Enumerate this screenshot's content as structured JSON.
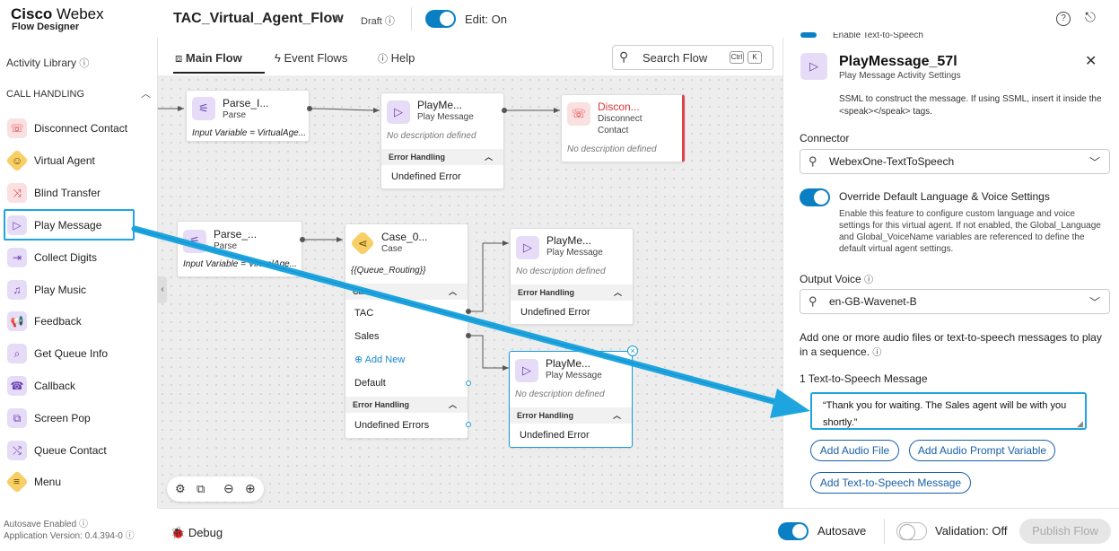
{
  "header": {
    "brand_line1_bold": "Cisco",
    "brand_line1_rest": " Webex",
    "brand_line2": "Flow Designer",
    "flow_name": "TAC_Virtual_Agent_Flow",
    "status": "Draft",
    "edit_label": "Edit: On"
  },
  "sidebar": {
    "activity_library": "Activity Library",
    "section": "CALL HANDLING",
    "items": [
      {
        "label": "Disconnect Contact",
        "icon": "phone-hangup-icon"
      },
      {
        "label": "Virtual Agent",
        "icon": "virtual-agent-icon"
      },
      {
        "label": "Blind Transfer",
        "icon": "transfer-icon"
      },
      {
        "label": "Play Message",
        "icon": "play-icon"
      },
      {
        "label": "Collect Digits",
        "icon": "collect-digits-icon"
      },
      {
        "label": "Play Music",
        "icon": "music-icon"
      },
      {
        "label": "Feedback",
        "icon": "feedback-icon"
      },
      {
        "label": "Get Queue Info",
        "icon": "queue-search-icon"
      },
      {
        "label": "Callback",
        "icon": "callback-icon"
      },
      {
        "label": "Screen Pop",
        "icon": "screen-pop-icon"
      },
      {
        "label": "Queue Contact",
        "icon": "queue-contact-icon"
      },
      {
        "label": "Menu",
        "icon": "menu-icon"
      }
    ],
    "autosave_note": "Autosave Enabled",
    "version": "Application Version: 0.4.394-0"
  },
  "tabs": [
    {
      "label": "Main Flow"
    },
    {
      "label": "Event Flows"
    },
    {
      "label": "Help"
    }
  ],
  "search": {
    "label": "Search Flow",
    "key1": "Ctrl",
    "key2": "K"
  },
  "nodes": {
    "parse1": {
      "title": "Parse_I...",
      "sub": "Parse",
      "desc": "Input Variable = VirtualAge..."
    },
    "play1": {
      "title": "PlayMe...",
      "sub": "Play Message",
      "desc": "No description defined",
      "err": "Error Handling",
      "row": "Undefined Error"
    },
    "disc": {
      "title": "Discon...",
      "sub1": "Disconnect",
      "sub2": "Contact",
      "desc": "No description defined"
    },
    "parse2": {
      "title": "Parse_...",
      "sub": "Parse",
      "desc": "Input Variable = VirtualAge..."
    },
    "case": {
      "title": "Case_0...",
      "sub": "Case",
      "desc": "{{Queue_Routing}}",
      "sec": "Case",
      "r1": "TAC",
      "r2": "Sales",
      "add": "Add New",
      "def": "Default",
      "err": "Error Handling",
      "errrow": "Undefined Errors"
    },
    "play2": {
      "title": "PlayMe...",
      "sub": "Play Message",
      "desc": "No description defined",
      "err": "Error Handling",
      "row": "Undefined Error"
    },
    "play3": {
      "title": "PlayMe...",
      "sub": "Play Message",
      "desc": "No description defined",
      "err": "Error Handling",
      "row": "Undefined Error"
    }
  },
  "panel": {
    "clipped_top": "Enable Text-to-Speech",
    "title": "PlayMessage_57l",
    "subtitle": "Play Message Activity Settings",
    "ssml_note": "SSML to construct the message. If using SSML, insert it inside the <speak></speak> tags.",
    "connector_label": "Connector",
    "connector_value": "WebexOne-TextToSpeech",
    "override_label": "Override Default Language & Voice Settings",
    "override_desc": "Enable this feature to configure custom language and voice settings for this virtual agent. If not enabled, the Global_Language and Global_VoiceName variables are referenced to define the default virtual agent settings.",
    "voice_label": "Output Voice",
    "voice_value": "en-GB-Wavenet-B",
    "add_note": "Add one or more audio files or text-to-speech messages to play in a sequence.",
    "tts_label": "1  Text-to-Speech Message",
    "tts_value": "“Thank you for waiting. The Sales agent will be with you shortly.”",
    "btn_audio": "Add Audio File",
    "btn_prompt": "Add Audio Prompt Variable",
    "btn_tts": "Add Text-to-Speech Message"
  },
  "bottom": {
    "debug": "Debug",
    "autosave": "Autosave",
    "validation": "Validation: Off",
    "publish": "Publish Flow"
  },
  "colors": {
    "accent": "#0a7fc4",
    "highlight": "#1ea5e0",
    "play_icon_bg": "#e6dcf7",
    "disconnect_red": "#e0424b"
  }
}
